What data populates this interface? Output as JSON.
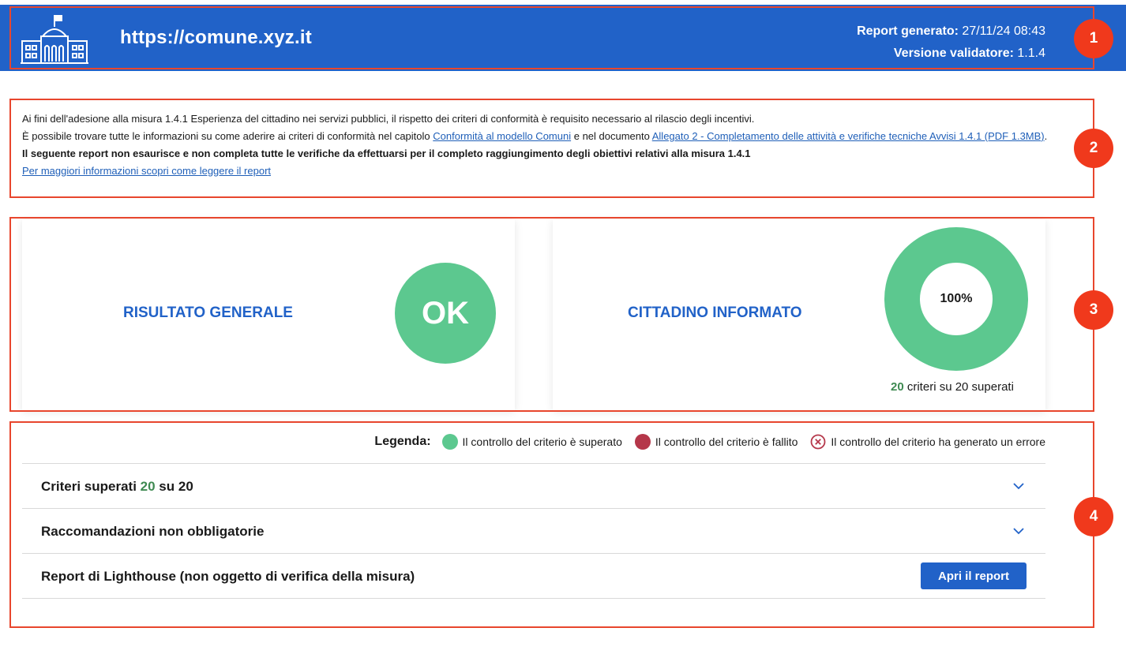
{
  "header": {
    "site_url": "https://comune.xyz.it",
    "report_label": "Report generato:",
    "report_value": "27/11/24 08:43",
    "version_label": "Versione validatore:",
    "version_value": "1.1.4"
  },
  "intro": {
    "line1": "Ai fini dell'adesione alla misura 1.4.1 Esperienza del cittadino nei servizi pubblici, il rispetto dei criteri di conformità è requisito necessario al rilascio degli incentivi.",
    "line2_prefix": "È possibile trovare tutte le informazioni su come aderire ai criteri di conformità nel capitolo ",
    "link1": "Conformità al modello Comuni",
    "line2_middle": " e nel documento ",
    "link2": "Allegato 2 - Completamento delle attività e verifiche tecniche Avvisi 1.4.1 (PDF 1.3MB)",
    "line2_suffix": ".",
    "bold_note": "Il seguente report non esaurisce e non completa tutte le verifiche da effettuarsi per il completo raggiungimento degli obiettivi relativi alla misura 1.4.1",
    "more_info_link": "Per maggiori informazioni scopri come leggere il report"
  },
  "summary": {
    "general_title": "RISULTATO GENERALE",
    "general_result": "OK",
    "citizen_title": "CITTADINO INFORMATO",
    "percentage": "100%",
    "passed_count": "20",
    "passed_suffix": " criteri su 20 superati",
    "pass_fraction": 1.0
  },
  "legend": {
    "label": "Legenda:",
    "passed": "Il controllo del criterio è superato",
    "failed": "Il controllo del criterio è fallito",
    "error": "Il controllo del criterio ha generato un errore"
  },
  "sections": {
    "criteria_prefix": "Criteri superati ",
    "criteria_count": "20",
    "criteria_suffix": " su 20",
    "recommendations": "Raccomandazioni non obbligatorie",
    "lighthouse": "Report di Lighthouse (non oggetto di verifica della misura)",
    "open_report_button": "Apri il report"
  },
  "annotations": [
    "1",
    "2",
    "3",
    "4"
  ],
  "colors": {
    "header_blue": "#2162c8",
    "pass_green": "#5cc88f",
    "fail_red": "#b5374a",
    "annotation_red": "#f0391c"
  },
  "icons": {
    "logo": "town-hall-icon",
    "chevron": "chevron-down-icon",
    "error": "error-x-circle-icon"
  }
}
